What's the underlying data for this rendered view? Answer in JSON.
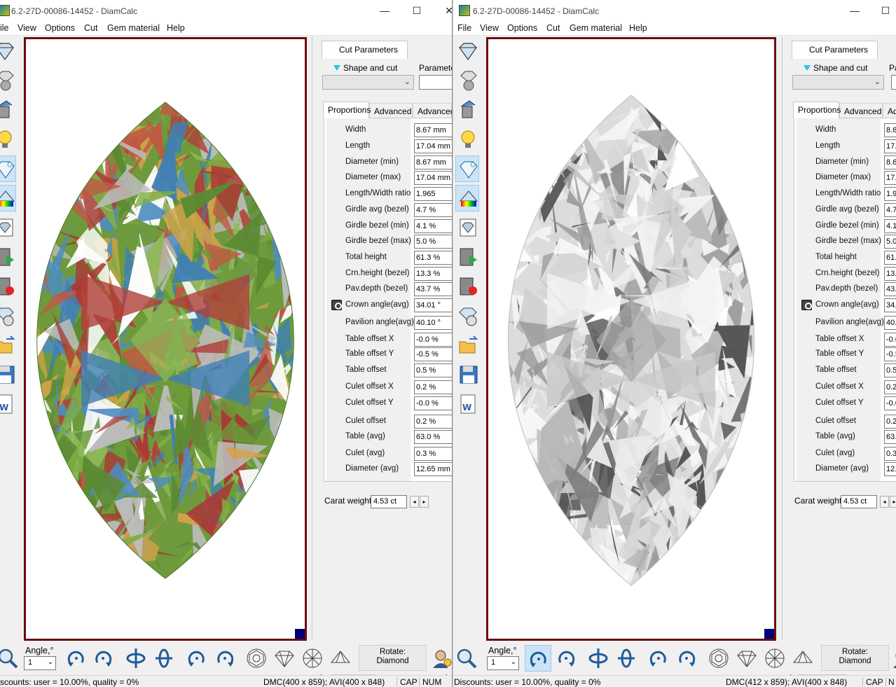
{
  "windows": [
    {
      "title": "6.2-27D-00086-14452 - DiamCalc",
      "menu": [
        "ile",
        "View",
        "Options",
        "Cut",
        "Gem material",
        "Help"
      ],
      "panel": {
        "tab": "Cut Parameters",
        "shape_label": "Shape and cut",
        "param_label": "Parameter",
        "subtabs": [
          "Proportions",
          "Advanced",
          "Advanced"
        ],
        "rows": [
          {
            "label": "Width",
            "value": "8.67 mm"
          },
          {
            "label": "Length",
            "value": "17.04 mm"
          },
          {
            "label": "Diameter (min)",
            "value": "8.67 mm"
          },
          {
            "label": "Diameter (max)",
            "value": "17.04 mm"
          },
          {
            "label": "Length/Width ratio",
            "value": "1.965"
          },
          {
            "label": "Girdle avg (bezel)",
            "value": "4.7 %"
          },
          {
            "label": "Girdle bezel (min)",
            "value": "4.1 %"
          },
          {
            "label": "Girdle bezel (max)",
            "value": "5.0 %"
          },
          {
            "label": "Total height",
            "value": "61.3 %"
          },
          {
            "label": "Crn.height (bezel)",
            "value": "13.3 %"
          },
          {
            "label": "Pav.depth (bezel)",
            "value": "43.7 %"
          },
          {
            "label": "Crown angle(avg)",
            "value": "34.01 °"
          },
          {
            "label": "Pavilion angle(avg)",
            "value": "40.10 °"
          },
          {
            "label": "Table offset X",
            "value": "-0.0 %"
          },
          {
            "label": "Table offset Y",
            "value": "-0.5 %"
          },
          {
            "label": "Table offset",
            "value": "0.5 %"
          },
          {
            "label": "Culet offset X",
            "value": "0.2 %"
          },
          {
            "label": "Culet offset Y",
            "value": "-0.0 %"
          },
          {
            "label": "Culet offset",
            "value": "0.2 %"
          },
          {
            "label": "Table (avg)",
            "value": "63.0 %"
          },
          {
            "label": "Culet (avg)",
            "value": "0.3 %"
          },
          {
            "label": "Diameter (avg)",
            "value": "12.65 mm"
          }
        ],
        "carat_label": "Carat weight",
        "carat_value": "4.53 ct"
      },
      "bottom": {
        "angle_label": "Angle,°",
        "angle_value": "1",
        "rotate_line1": "Rotate:",
        "rotate_line2": "Diamond"
      },
      "status": {
        "left": "scounts: user = 10.00%, quality = 0%",
        "mid": "DMC(400 x 859); AVI(400 x 848)",
        "cap": "CAP",
        "num": "NUM"
      },
      "gem_style": "colored"
    },
    {
      "title": "6.2-27D-00086-14452 - DiamCalc",
      "menu": [
        "File",
        "View",
        "Options",
        "Cut",
        "Gem material",
        "Help"
      ],
      "panel": {
        "tab": "Cut Parameters",
        "shape_label": "Shape and cut",
        "param_label": "Pa",
        "subtabs": [
          "Proportions",
          "Advanced",
          "Adv"
        ],
        "rows": [
          {
            "label": "Width",
            "value": "8.6"
          },
          {
            "label": "Length",
            "value": "17.0"
          },
          {
            "label": "Diameter (min)",
            "value": "8.6"
          },
          {
            "label": "Diameter (max)",
            "value": "17.0"
          },
          {
            "label": "Length/Width ratio",
            "value": "1.9"
          },
          {
            "label": "Girdle avg (bezel)",
            "value": "4.7"
          },
          {
            "label": "Girdle bezel (min)",
            "value": "4.1"
          },
          {
            "label": "Girdle bezel (max)",
            "value": "5.0"
          },
          {
            "label": "Total height",
            "value": "61.3"
          },
          {
            "label": "Crn.height (bezel)",
            "value": "13.3"
          },
          {
            "label": "Pav.depth (bezel)",
            "value": "43.7"
          },
          {
            "label": "Crown angle(avg)",
            "value": "34.0"
          },
          {
            "label": "Pavilion angle(avg)",
            "value": "40.1"
          },
          {
            "label": "Table offset X",
            "value": "-0.0"
          },
          {
            "label": "Table offset Y",
            "value": "-0.5"
          },
          {
            "label": "Table offset",
            "value": "0.5"
          },
          {
            "label": "Culet offset X",
            "value": "0.2"
          },
          {
            "label": "Culet offset Y",
            "value": "-0.0"
          },
          {
            "label": "Culet offset",
            "value": "0.2"
          },
          {
            "label": "Table (avg)",
            "value": "63.0"
          },
          {
            "label": "Culet (avg)",
            "value": "0.3"
          },
          {
            "label": "Diameter (avg)",
            "value": "12.6"
          }
        ],
        "carat_label": "Carat weight",
        "carat_value": "4.53 ct"
      },
      "bottom": {
        "angle_label": "Angle,°",
        "angle_value": "1",
        "rotate_line1": "Rotate:",
        "rotate_line2": "Diamond"
      },
      "status": {
        "left": "Discounts: user = 10.00%, quality = 0%",
        "mid": "DMC(412 x 859); AVI(400 x 848)",
        "cap": "CAP",
        "num": "N"
      },
      "gem_style": "white"
    }
  ],
  "colors": {
    "viewport_border": "#6b0d0d",
    "gem_green": "#6e9a3c",
    "gem_red": "#b0403a",
    "gem_blue": "#3f7fb5",
    "gem_white": "#e8e8e8"
  }
}
